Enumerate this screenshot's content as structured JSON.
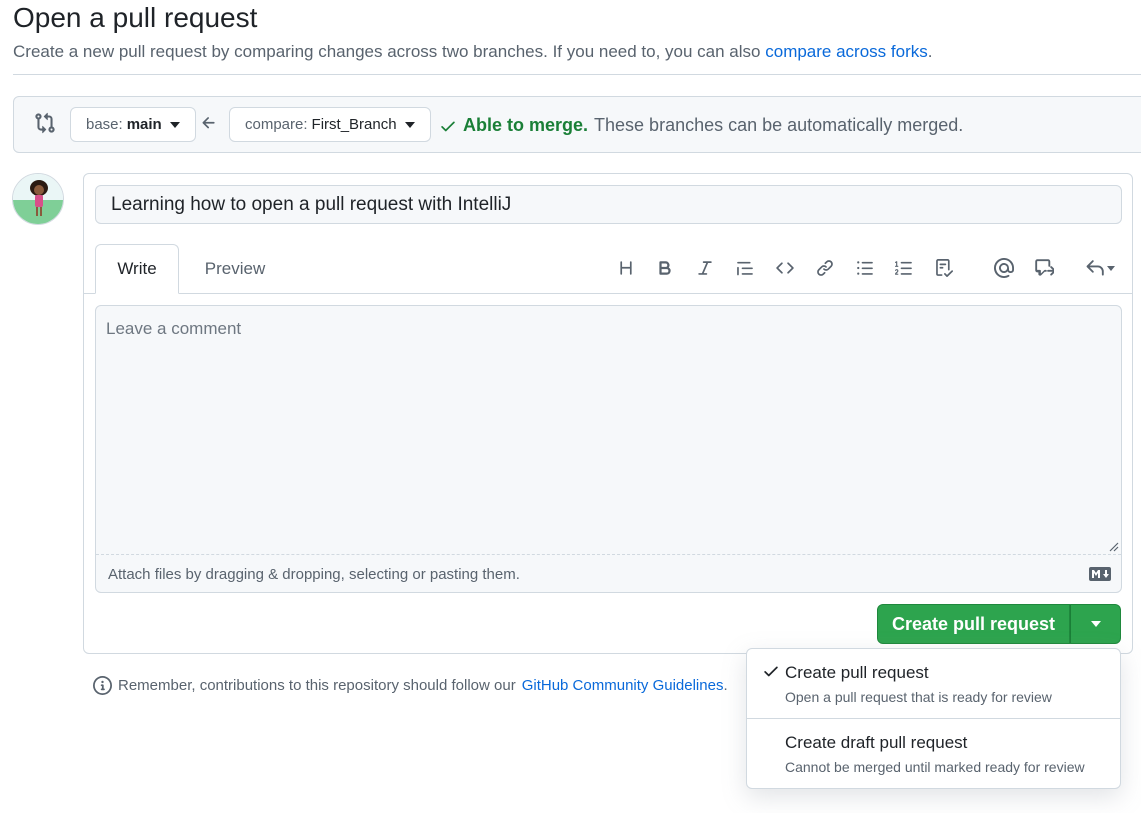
{
  "header": {
    "title": "Open a pull request",
    "subtitle": "Create a new pull request by comparing changes across two branches. If you need to, you can also",
    "subtitle_link": "compare across forks",
    "subtitle_end": "."
  },
  "compare": {
    "base_prefix": "base:",
    "base_branch": "main",
    "compare_prefix": "compare:",
    "compare_branch": "First_Branch",
    "merge_ok": "Able to merge.",
    "merge_text": "These branches can be automatically merged."
  },
  "form": {
    "title_value": "Learning how to open a pull request with IntelliJ",
    "tabs": [
      {
        "label": "Write"
      },
      {
        "label": "Preview"
      }
    ],
    "comment_placeholder": "Leave a comment",
    "attach_text": "Attach files by dragging & dropping, selecting or pasting them.",
    "submit_label": "Create pull request"
  },
  "toolbar_icons": [
    "heading-icon",
    "bold-icon",
    "italic-icon",
    "quote-icon",
    "code-icon",
    "link-icon",
    "bulleted-list-icon",
    "numbered-list-icon",
    "task-list-icon",
    "mention-icon",
    "cross-reference-icon",
    "reply-icon"
  ],
  "guidelines": {
    "text": "Remember, contributions to this repository should follow our",
    "link": "GitHub Community Guidelines",
    "end": "."
  },
  "dropdown": {
    "items": [
      {
        "title": "Create pull request",
        "description": "Open a pull request that is ready for review",
        "selected": true
      },
      {
        "title": "Create draft pull request",
        "description": "Cannot be merged until marked ready for review",
        "selected": false
      }
    ]
  },
  "colors": {
    "accent_green": "#2da44e",
    "success_text": "#1a7f37",
    "link_blue": "#0969da",
    "border": "#d1d9e0",
    "muted_bg": "#f6f8fa"
  }
}
